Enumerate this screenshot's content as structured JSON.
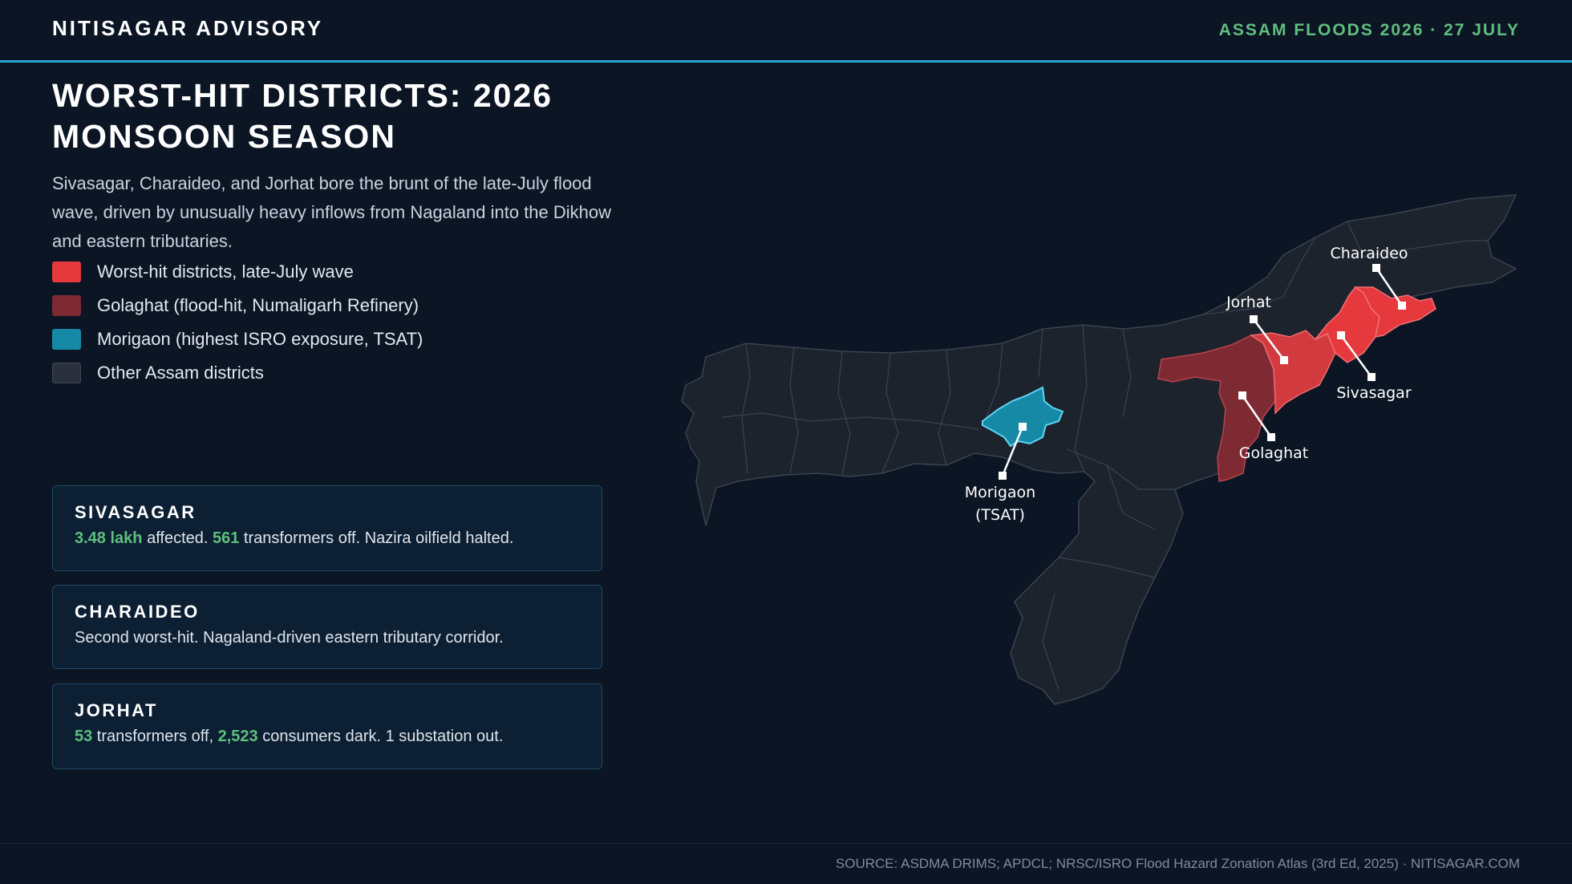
{
  "header": {
    "brand": "NITISAGAR ADVISORY",
    "dateline": "ASSAM FLOODS 2026 · 27 JULY",
    "accent_color": "#2aa7d8"
  },
  "title": {
    "line1": "WORST-HIT DISTRICTS: 2026",
    "line2": "MONSOON SEASON"
  },
  "lede": "Sivasagar, Charaideo, and Jorhat bore the brunt of the late-July flood wave, driven by unusually heavy inflows from Nagaland into the Dikhow and eastern tributaries.",
  "legend": [
    {
      "label": "Worst-hit districts, late-July wave",
      "color": "#e5393d"
    },
    {
      "label": "Golaghat (flood-hit, Numaligarh Refinery)",
      "color": "#7d2a33"
    },
    {
      "label": "Morigaon (highest ISRO exposure, TSAT)",
      "color": "#1589a6"
    },
    {
      "label": "Other Assam districts",
      "color": "#2a313c"
    }
  ],
  "cards": [
    {
      "title": "SIVASAGAR",
      "parts": [
        {
          "text": "3.48 lakh",
          "highlight": true
        },
        {
          "text": " affected. ",
          "highlight": false
        },
        {
          "text": "561",
          "highlight": true
        },
        {
          "text": " transformers off. Nazira oilfield halted.",
          "highlight": false
        }
      ]
    },
    {
      "title": "CHARAIDEO",
      "parts": [
        {
          "text": "Second worst-hit. Nagaland-driven eastern tributary corridor.",
          "highlight": false
        }
      ]
    },
    {
      "title": "JORHAT",
      "parts": [
        {
          "text": "53",
          "highlight": true
        },
        {
          "text": " transformers off, ",
          "highlight": false
        },
        {
          "text": "2,523",
          "highlight": true
        },
        {
          "text": " consumers dark. 1 substation out.",
          "highlight": false
        }
      ]
    }
  ],
  "map": {
    "labels": {
      "charaideo": "Charaideo",
      "jorhat": "Jorhat",
      "sivasagar": "Sivasagar",
      "golaghat": "Golaghat",
      "morigaon_line1": "Morigaon",
      "morigaon_line2": "(TSAT)"
    },
    "colors": {
      "worst_hit": "#e5393d",
      "golaghat": "#7d2a33",
      "morigaon": "#1589a6",
      "other": "#1d232d",
      "border": "#3a424e"
    }
  },
  "footer": {
    "source": "SOURCE: ASDMA DRIMS; APDCL; NRSC/ISRO Flood Hazard Zonation Atlas (3rd Ed, 2025) · NITISAGAR.COM"
  }
}
